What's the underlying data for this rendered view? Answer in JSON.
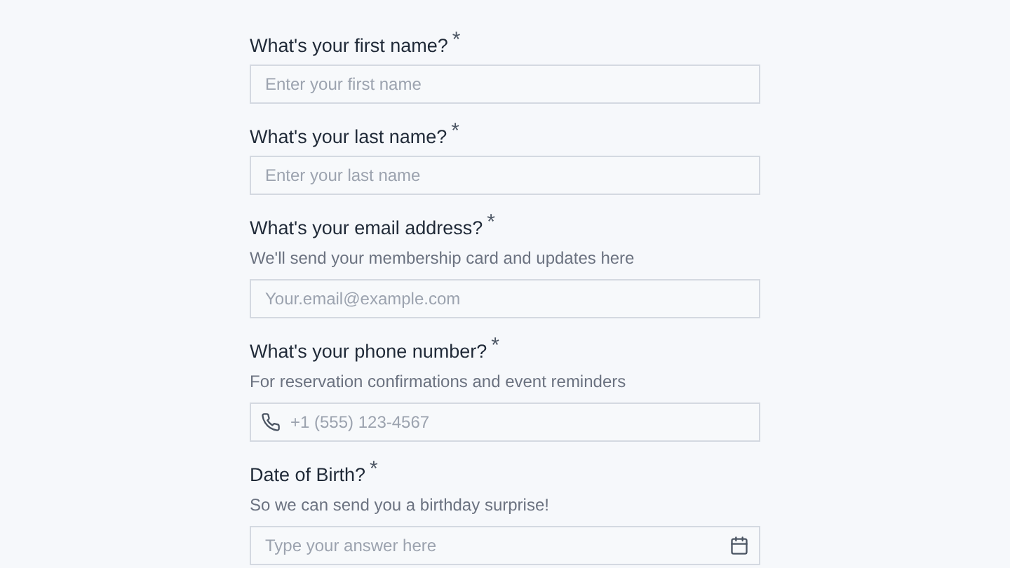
{
  "questions": [
    {
      "label": "What's your first name?",
      "required_mark": "*",
      "kind": "text",
      "placeholder": "Enter your first name"
    },
    {
      "label": "What's your last name?",
      "required_mark": "*",
      "kind": "text",
      "placeholder": "Enter your last name"
    },
    {
      "label": "What's your email address?",
      "required_mark": "*",
      "hint": "We'll send your membership card and updates here",
      "kind": "text",
      "placeholder": "Your.email@example.com"
    },
    {
      "label": "What's your phone number?",
      "required_mark": "*",
      "hint": "For reservation confirmations and event reminders",
      "kind": "phone",
      "placeholder": "+1 (555) 123-4567"
    },
    {
      "label": "Date of Birth?",
      "required_mark": "*",
      "hint": "So we can send you a birthday surprise!",
      "kind": "date",
      "placeholder": "Type your answer here"
    }
  ]
}
